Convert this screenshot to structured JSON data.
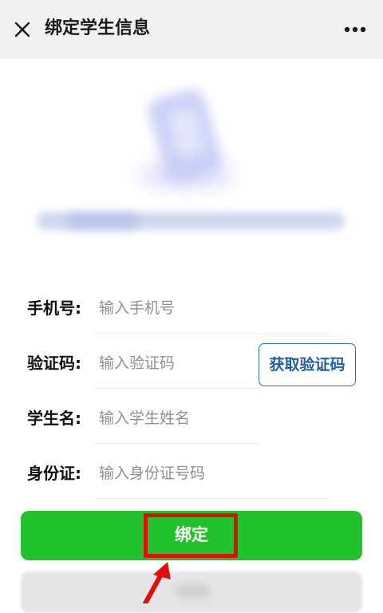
{
  "header": {
    "title": "绑定学生信息",
    "close_icon": "close-icon",
    "more_icon": "more-horizontal-icon"
  },
  "hero": {
    "image": "blurred-phone-illustration"
  },
  "form": {
    "phone": {
      "label": "手机号:",
      "placeholder": "输入手机号",
      "value": ""
    },
    "code": {
      "label": "验证码:",
      "placeholder": "输入验证码",
      "value": "",
      "get_code_label": "获取验证码"
    },
    "student_name": {
      "label": "学生名:",
      "placeholder": "输入学生姓名",
      "value": ""
    },
    "id_card": {
      "label": "身份证:",
      "placeholder": "输入身份证号码",
      "value": ""
    }
  },
  "actions": {
    "bind_label": "绑定"
  },
  "colors": {
    "primary_green": "#21c22c",
    "link_blue": "#2d73b8",
    "highlight_red": "#e10e0e",
    "header_bg": "#f1f1f1"
  }
}
